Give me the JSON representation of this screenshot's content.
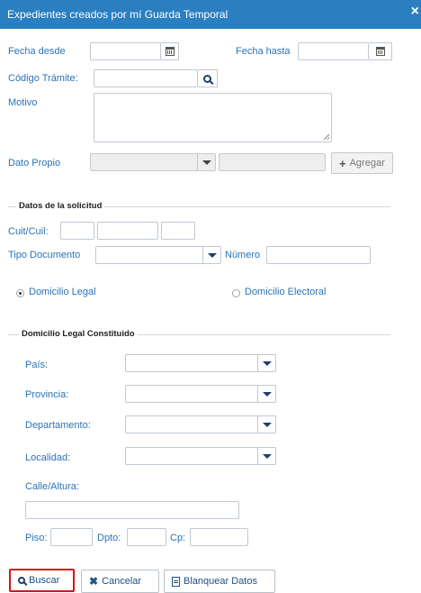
{
  "modal": {
    "title": "Expedientes creados por mí Guarda Temporal",
    "close": "×"
  },
  "form": {
    "fecha_desde_label": "Fecha desde",
    "fecha_hasta_label": "Fecha hasta",
    "codigo_tramite_label": "Código Trámite:",
    "motivo_label": "Motivo",
    "dato_propio_label": "Dato Propio",
    "agregar_label": "Agregar"
  },
  "solicitud": {
    "legend": "Datos de la solicitud",
    "cuit_label": "Cuit/Cuil:",
    "tipo_documento_label": "Tipo Documento",
    "numero_label": "Número"
  },
  "domicilio": {
    "legal_label": "Domicilio Legal",
    "electoral_label": "Domicilio Electoral",
    "selected": "Domicilio Legal"
  },
  "constituido": {
    "legend": "Domicilio Legal Constituido",
    "pais_label": "País:",
    "provincia_label": "Provincia:",
    "departamento_label": "Departamento:",
    "localidad_label": "Localidad:",
    "calle_label": "Calle/Altura:",
    "piso_label": "Piso:",
    "dpto_label": "Dpto:",
    "cp_label": "Cp:"
  },
  "actions": {
    "buscar": "Buscar",
    "cancelar": "Cancelar",
    "blanquear": "Blanquear Datos"
  }
}
